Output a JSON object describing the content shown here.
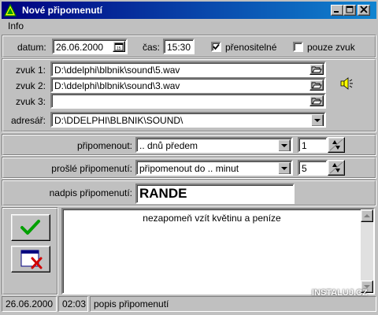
{
  "window": {
    "title": "Nové připomenutí"
  },
  "menu": {
    "info": "Info"
  },
  "top": {
    "date_label": "datum:",
    "date_value": "26.06.2000",
    "time_label": "čas:",
    "time_value": "15:30",
    "transferable_label": "přenositelné",
    "transferable_checked": true,
    "sound_only_label": "pouze zvuk",
    "sound_only_checked": false
  },
  "sounds": {
    "sound1_label": "zvuk 1:",
    "sound1_value": "D:\\ddelphi\\blbnik\\sound\\5.wav",
    "sound2_label": "zvuk 2:",
    "sound2_value": "D:\\ddelphi\\blbnik\\sound\\3.wav",
    "sound3_label": "zvuk 3:",
    "sound3_value": "",
    "dir_label": "adresář:",
    "dir_value": "D:\\DDELPHI\\BLBNIK\\SOUND\\"
  },
  "remind": {
    "label": "připomenout:",
    "value": ".. dnů předem",
    "count": "1"
  },
  "expired": {
    "label": "prošlé připomenutí:",
    "value": "připomenout do .. minut",
    "count": "5"
  },
  "caption": {
    "label": "nadpis připomenutí:",
    "value": "RANDE"
  },
  "memo": {
    "text": "nezapomeň vzít květinu a peníze"
  },
  "status": {
    "date": "26.06.2000",
    "time": "02:03",
    "hint": "popis připomenutí"
  },
  "watermark": "INSTALUJ.CZ",
  "colors": {
    "titlebar": "#000080",
    "ok_check": "#00a000",
    "cancel_x": "#d00000"
  }
}
